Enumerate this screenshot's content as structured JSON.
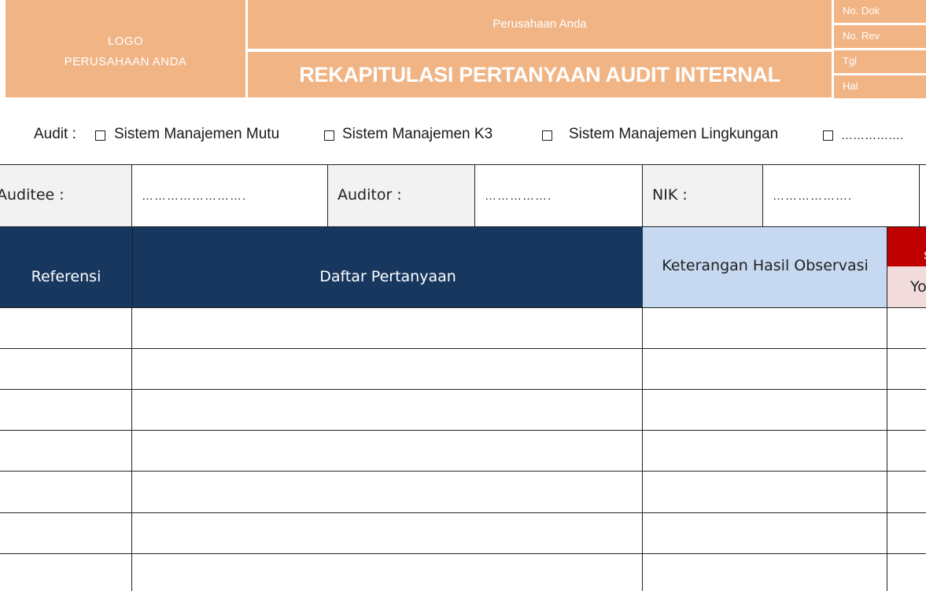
{
  "header": {
    "logo_line1": "LOGO",
    "logo_line2": "PERUSAHAAN ANDA",
    "company": "Perusahaan Anda",
    "title": "REKAPITULASI PERTANYAAN AUDIT INTERNAL",
    "meta": [
      "No. Dok",
      "No. Rev",
      "Tgl",
      "Hal"
    ]
  },
  "audit": {
    "label": "Audit :",
    "options": [
      "Sistem Manajemen  Mutu",
      "Sistem Manajemen  K3",
      "Sistem Manajemen  Lingkungan",
      "……………."
    ]
  },
  "info": {
    "auditee_label": "Auditee  :",
    "auditee_value": "…………………….",
    "auditor_label": "Auditor :",
    "auditor_value": "…………….",
    "nik_label": "NIK :",
    "nik_value": "………………."
  },
  "table": {
    "columns": [
      "Referensi",
      "Daftar Pertanyaan",
      "Keterangan Hasil Observasi"
    ],
    "partial_header_bottom": "Yo",
    "partial_header_top": "S",
    "rows": 7
  },
  "colors": {
    "header_orange": "#f1b485",
    "navy": "#17375e",
    "light_blue": "#c6d9f0",
    "red": "#c00000",
    "pink": "#f2dcdb",
    "gray_cell": "#f2f2f2"
  }
}
